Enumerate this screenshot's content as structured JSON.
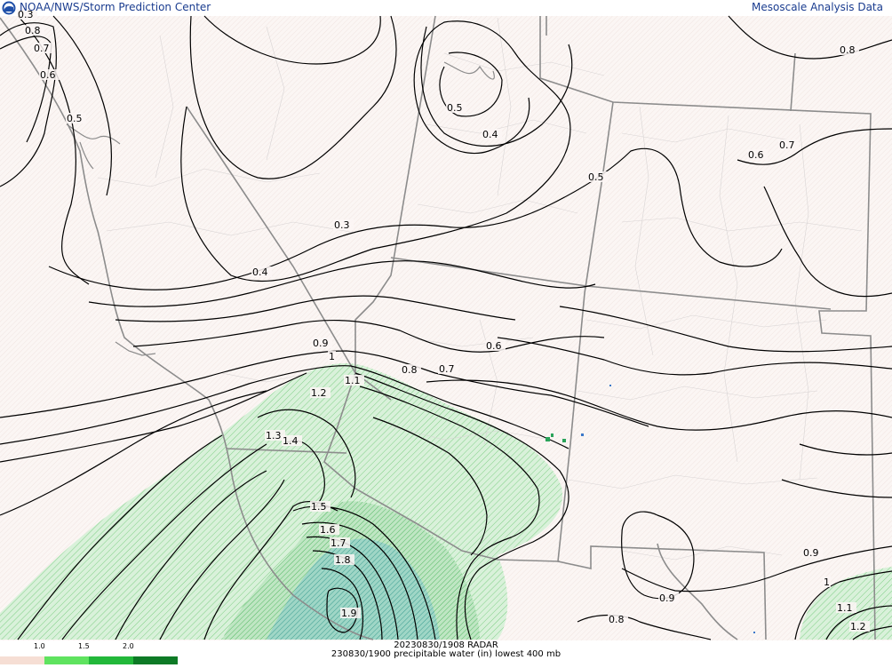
{
  "header": {
    "left_title": "NOAA/NWS/Storm Prediction Center",
    "right_title": "Mesoscale Analysis Data"
  },
  "legend": {
    "ticks": [
      "1.0",
      "1.5",
      "2.0"
    ],
    "colors": [
      "#f5ddd2",
      "#5de05d",
      "#22b83a",
      "#0d7a26"
    ]
  },
  "footer": {
    "radar_line": "20230830/1908 RADAR",
    "product_line": "230830/1900 precipitable water (in) lowest 400 mb"
  },
  "contour_labels": [
    {
      "text": "0.8"
    },
    {
      "text": "0.7"
    },
    {
      "text": "0.6"
    },
    {
      "text": "0.5"
    },
    {
      "text": "0.3"
    },
    {
      "text": "0.5"
    },
    {
      "text": "0.4"
    },
    {
      "text": "0.8"
    },
    {
      "text": "0.7"
    },
    {
      "text": "0.6"
    },
    {
      "text": "0.5"
    },
    {
      "text": "0.3"
    },
    {
      "text": "0.4"
    },
    {
      "text": "0.9"
    },
    {
      "text": "1"
    },
    {
      "text": "1.1"
    },
    {
      "text": "0.8"
    },
    {
      "text": "0.7"
    },
    {
      "text": "0.6"
    },
    {
      "text": "1.2"
    },
    {
      "text": "1.3"
    },
    {
      "text": "1.4"
    },
    {
      "text": "1.5"
    },
    {
      "text": "1.6"
    },
    {
      "text": "1.7"
    },
    {
      "text": "1.8"
    },
    {
      "text": "1.9"
    },
    {
      "text": "0.9"
    },
    {
      "text": "0.9"
    },
    {
      "text": "0.8"
    },
    {
      "text": "1"
    },
    {
      "text": "1.1"
    },
    {
      "text": "1.2"
    }
  ],
  "colors": {
    "background": "#faf4f2",
    "pw_light": "#c9eccb",
    "pw_mid": "#9fdca5",
    "pw_dark": "#5fbdb0",
    "state_border": "#8a8a8a",
    "county_border": "#d2d2d2",
    "contour": "#000000"
  }
}
